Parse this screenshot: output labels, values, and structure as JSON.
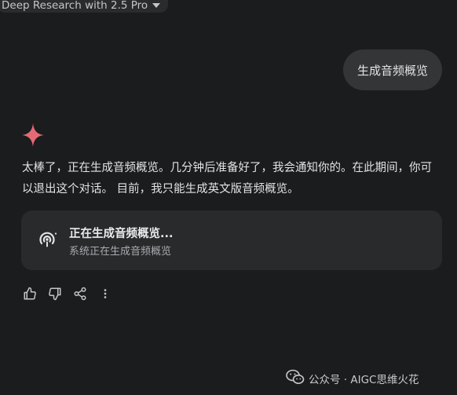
{
  "header": {
    "model_label": "Deep Research with 2.5 Pro"
  },
  "user_message": "生成音频概览",
  "assistant": {
    "message": "太棒了，正在生成音频概览。几分钟后准备好了，我会通知你的。在此期间，你可以退出这个对话。 目前，我只能生成英文版音频概览。"
  },
  "audio_card": {
    "title": "正在生成音频概览...",
    "subtitle": "系统正在生成音频概览"
  },
  "actions": [
    "thumbs-up-icon",
    "thumbs-down-icon",
    "share-icon",
    "more-vert-icon"
  ],
  "watermark": {
    "text": "公众号 · AIGC思维火花"
  },
  "colors": {
    "background": "#1b1c1d",
    "bubble": "#333537",
    "card": "#282a2c",
    "gemini_star": "#e56a75"
  }
}
